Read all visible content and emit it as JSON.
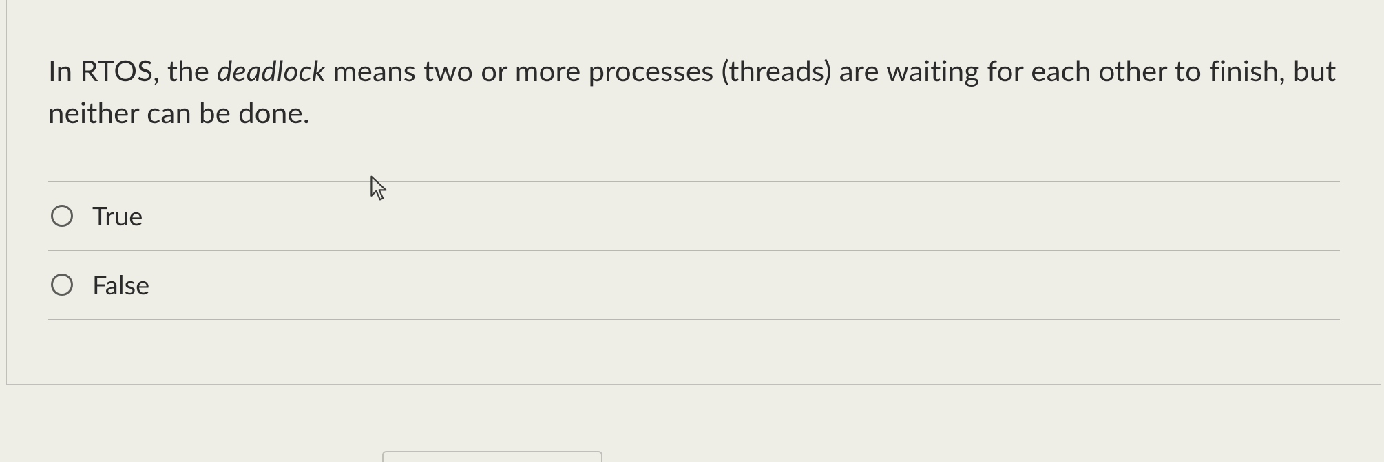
{
  "question": {
    "prefix": "In RTOS, the ",
    "italic": "deadlock",
    "suffix": " means two or more processes (threads) are waiting for each other to finish, but neither can be done."
  },
  "options": [
    {
      "label": "True"
    },
    {
      "label": "False"
    }
  ]
}
